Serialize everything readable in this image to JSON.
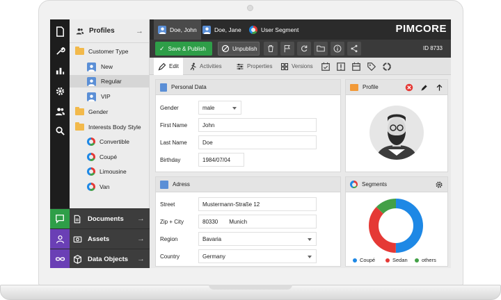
{
  "tree": {
    "header": "Profiles",
    "items": [
      {
        "label": "Customer Type",
        "kind": "folder"
      },
      {
        "label": "New",
        "kind": "user"
      },
      {
        "label": "Regular",
        "kind": "user"
      },
      {
        "label": "VIP",
        "kind": "user"
      },
      {
        "label": "Gender",
        "kind": "folder"
      },
      {
        "label": "Interests Body Style",
        "kind": "folder"
      },
      {
        "label": "Convertible",
        "kind": "segment"
      },
      {
        "label": "Coupé",
        "kind": "segment"
      },
      {
        "label": "Limousine",
        "kind": "segment"
      },
      {
        "label": "Van",
        "kind": "segment"
      }
    ]
  },
  "accordion": {
    "documents": "Documents",
    "assets": "Assets",
    "data_objects": "Data Objects"
  },
  "tabs": [
    {
      "label": "Doe, John"
    },
    {
      "label": "Doe, Jane"
    },
    {
      "label": "User Segment"
    }
  ],
  "brand": {
    "logo": "PIMCORE"
  },
  "toolbar": {
    "save_publish": "Save & Publish",
    "unpublish": "Unpublish",
    "id_label": "ID 8733"
  },
  "subtabs": {
    "edit": "Edit",
    "activities": "Activities",
    "properties": "Properties",
    "versions": "Versions"
  },
  "personal": {
    "title": "Personal Data",
    "gender_label": "Gender",
    "gender_value": "male",
    "first_name_label": "First Name",
    "first_name_value": "John",
    "last_name_label": "Last Name",
    "last_name_value": "Doe",
    "birthday_label": "Birthday",
    "birthday_value": "1984/07/04"
  },
  "address": {
    "title": "Adress",
    "street_label": "Street",
    "street_value": "Mustermann-Straße 12",
    "zip_city_label": "Zip + City",
    "zip_value": "80330",
    "city_value": "Munich",
    "region_label": "Region",
    "region_value": "Bavaria",
    "country_label": "Country",
    "country_value": "Germany"
  },
  "profile": {
    "title": "Profile"
  },
  "segments": {
    "title": "Segments",
    "legend": [
      "Coupé",
      "Sedan",
      "others"
    ]
  },
  "chart_data": {
    "type": "pie",
    "donut": true,
    "categories": [
      "Coupé",
      "Sedan",
      "others"
    ],
    "values": [
      50,
      37,
      13
    ],
    "colors": [
      "#1e88e5",
      "#e53935",
      "#43a047"
    ],
    "legend_position": "bottom"
  },
  "colors": {
    "green": "#2e9e48",
    "accent_blue": "#5b8fd6",
    "chat": "#2e9e48",
    "user": "#6a3fb5",
    "infinity": "#6a3fb5"
  }
}
